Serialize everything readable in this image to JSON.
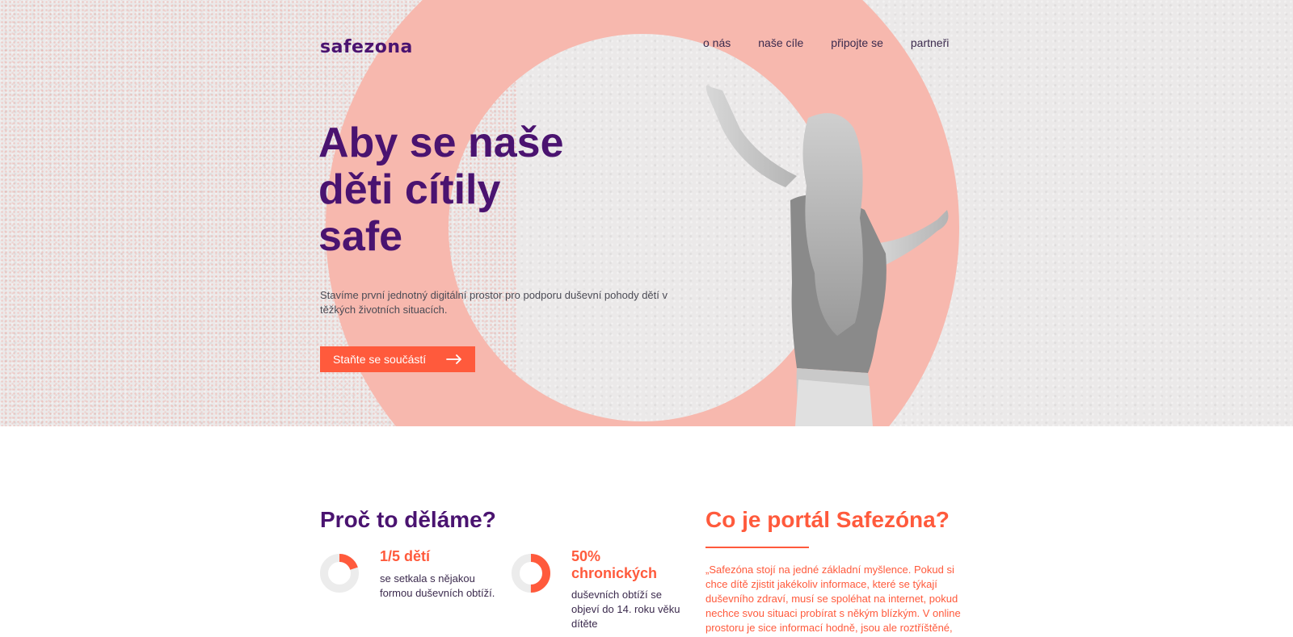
{
  "brand": {
    "logo": "safezona"
  },
  "nav": {
    "items": [
      "o nás",
      "naše cíle",
      "připojte se",
      "partneři"
    ]
  },
  "hero": {
    "title_line1": "Aby se naše",
    "title_line2": "děti cítily",
    "title_emphasis": "safe",
    "subtitle": "Stavíme první jednotný digitální prostor pro podporu duševní pohody dětí v těžkých životních situacích.",
    "cta_label": "Staňte se součástí"
  },
  "why": {
    "title_plain": "Proč to ",
    "title_bold": "děláme?",
    "stats": [
      {
        "value": "1/5 dětí",
        "description": "se setkala s nějakou formou duševních obtíží.",
        "fraction": 0.2
      },
      {
        "value": "50% chronických",
        "description": "duševních obtíží se objeví do 14. roku věku dítěte",
        "fraction": 0.5
      }
    ]
  },
  "portal": {
    "title_plain": "Co je portál ",
    "title_bold": "Safezóna?",
    "quote": "„Safezóna stojí na jedné základní myšlence. Pokud si chce dítě zjistit jakékoliv informace, které se týkají duševního zdraví, musí se spoléhat na internet, pokud nechce svou situaci probírat s někým blízkým. V online prostoru je sice informací hodně, jsou ale roztříštěné,"
  },
  "colors": {
    "purple": "#4a1370",
    "accent": "#ff5a3c",
    "ring": "#f7b8ae",
    "donut_track": "#ececec"
  }
}
